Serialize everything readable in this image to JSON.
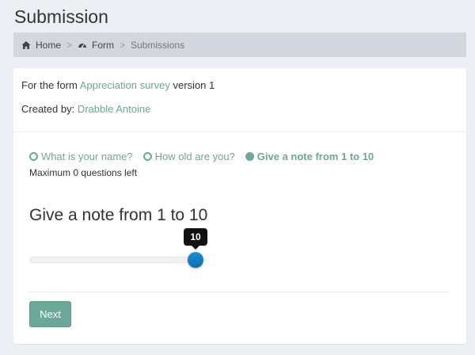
{
  "page": {
    "title": "Submission"
  },
  "breadcrumb": {
    "items": [
      {
        "label": "Home",
        "icon": "home-icon"
      },
      {
        "label": "Form",
        "icon": "dashboard-icon"
      },
      {
        "label": "Submissions"
      }
    ],
    "separator": ">"
  },
  "info": {
    "form_prefix": "For the form",
    "form_name": "Appreciation survey",
    "form_suffix": "version 1",
    "created_label": "Created by:",
    "created_by": "Drabble Antoine"
  },
  "steps": [
    {
      "label": "What is your name?",
      "state": "done"
    },
    {
      "label": "How old are you?",
      "state": "done"
    },
    {
      "label": "Give a note from 1 to 10",
      "state": "current"
    }
  ],
  "remaining": "Maximum 0 questions left",
  "question": {
    "text": "Give a note from 1 to 10",
    "slider": {
      "min": 1,
      "max": 10,
      "value": 10,
      "tooltip": "10"
    }
  },
  "actions": {
    "next_label": "Next"
  },
  "colors": {
    "accent": "#6aa89a",
    "handle": "#0b6fb4",
    "breadcrumb_bg": "#d2d6de",
    "background": "#ecf0f5"
  }
}
